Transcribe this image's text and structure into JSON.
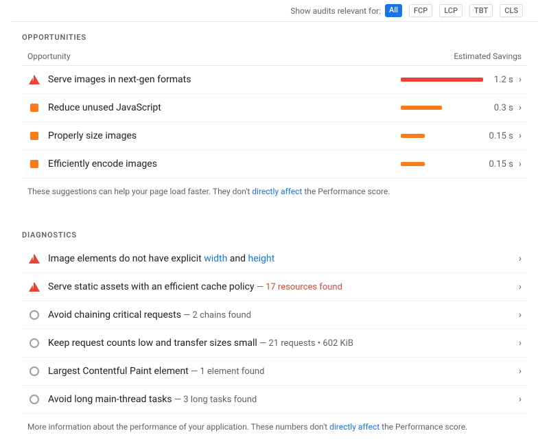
{
  "topBar": {
    "label": "Show audits relevant for:",
    "badges": [
      "All",
      "FCP",
      "LCP",
      "TBT",
      "CLS"
    ]
  },
  "opportunities": {
    "sectionTitle": "OPPORTUNITIES",
    "columnOpportunity": "Opportunity",
    "columnSavings": "Estimated Savings",
    "rows": [
      {
        "id": "serve-images-nextgen",
        "iconType": "triangle-red",
        "label": "Serve images in next-gen formats",
        "barColor": "#ea4335",
        "barWidth": 120,
        "savings": "1.2 s"
      },
      {
        "id": "reduce-unused-js",
        "iconType": "square-orange",
        "label": "Reduce unused JavaScript",
        "barColor": "#fa7b17",
        "barWidth": 60,
        "savings": "0.3 s"
      },
      {
        "id": "properly-size-images",
        "iconType": "square-orange",
        "label": "Properly size images",
        "barColor": "#fa7b17",
        "barWidth": 35,
        "savings": "0.15 s"
      },
      {
        "id": "efficiently-encode-images",
        "iconType": "square-orange",
        "label": "Efficiently encode images",
        "barColor": "#fa7b17",
        "barWidth": 35,
        "savings": "0.15 s"
      }
    ],
    "footerNote": "These suggestions can help your page load faster. They don't ",
    "footerLinkText": "directly affect",
    "footerNoteEnd": " the Performance score."
  },
  "diagnostics": {
    "sectionTitle": "DIAGNOSTICS",
    "rows": [
      {
        "id": "image-explicit-dimensions",
        "iconType": "triangle-red",
        "labelMain": "Image elements do not have explicit ",
        "labelLink1Text": "width",
        "labelMiddle": " and ",
        "labelLink2Text": "height",
        "labelEnd": ""
      },
      {
        "id": "efficient-cache-policy",
        "iconType": "triangle-red",
        "labelMain": "Serve static assets with an efficient cache policy",
        "subText": " — 17 resources found",
        "subTextColor": "red"
      },
      {
        "id": "avoid-chaining-requests",
        "iconType": "circle-gray",
        "labelMain": "Avoid chaining critical requests",
        "subText": " — 2 chains found",
        "subTextColor": "gray"
      },
      {
        "id": "keep-request-counts-low",
        "iconType": "circle-gray",
        "labelMain": "Keep request counts low and transfer sizes small",
        "subText": " — 21 requests • 602 KiB",
        "subTextColor": "gray"
      },
      {
        "id": "lcp-element",
        "iconType": "circle-gray",
        "labelMain": "Largest Contentful Paint element",
        "subText": " — 1 element found",
        "subTextColor": "gray"
      },
      {
        "id": "avoid-long-tasks",
        "iconType": "circle-gray",
        "labelMain": "Avoid long main-thread tasks",
        "subText": " — 3 long tasks found",
        "subTextColor": "gray"
      }
    ],
    "footerNote": "More information about the performance of your application. These numbers don't ",
    "footerLinkText": "directly affect",
    "footerNoteEnd": " the Performance score."
  }
}
